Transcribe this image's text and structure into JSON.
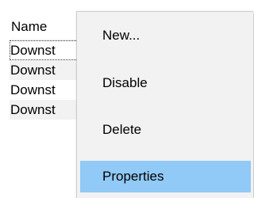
{
  "list": {
    "columns": [
      "Name"
    ],
    "rows": [
      {
        "name": "Downst"
      },
      {
        "name": "Downst"
      },
      {
        "name": "Downst"
      },
      {
        "name": "Downst"
      }
    ]
  },
  "context_menu": {
    "items": [
      {
        "label": "New...",
        "highlighted": false
      },
      {
        "label": "Disable",
        "highlighted": false
      },
      {
        "label": "Delete",
        "highlighted": false
      },
      {
        "label": "Properties",
        "highlighted": true
      }
    ]
  },
  "colors": {
    "menu_background": "#f2f2f2",
    "highlight": "#91c9f7",
    "row_alt": "#f2f2f2"
  }
}
